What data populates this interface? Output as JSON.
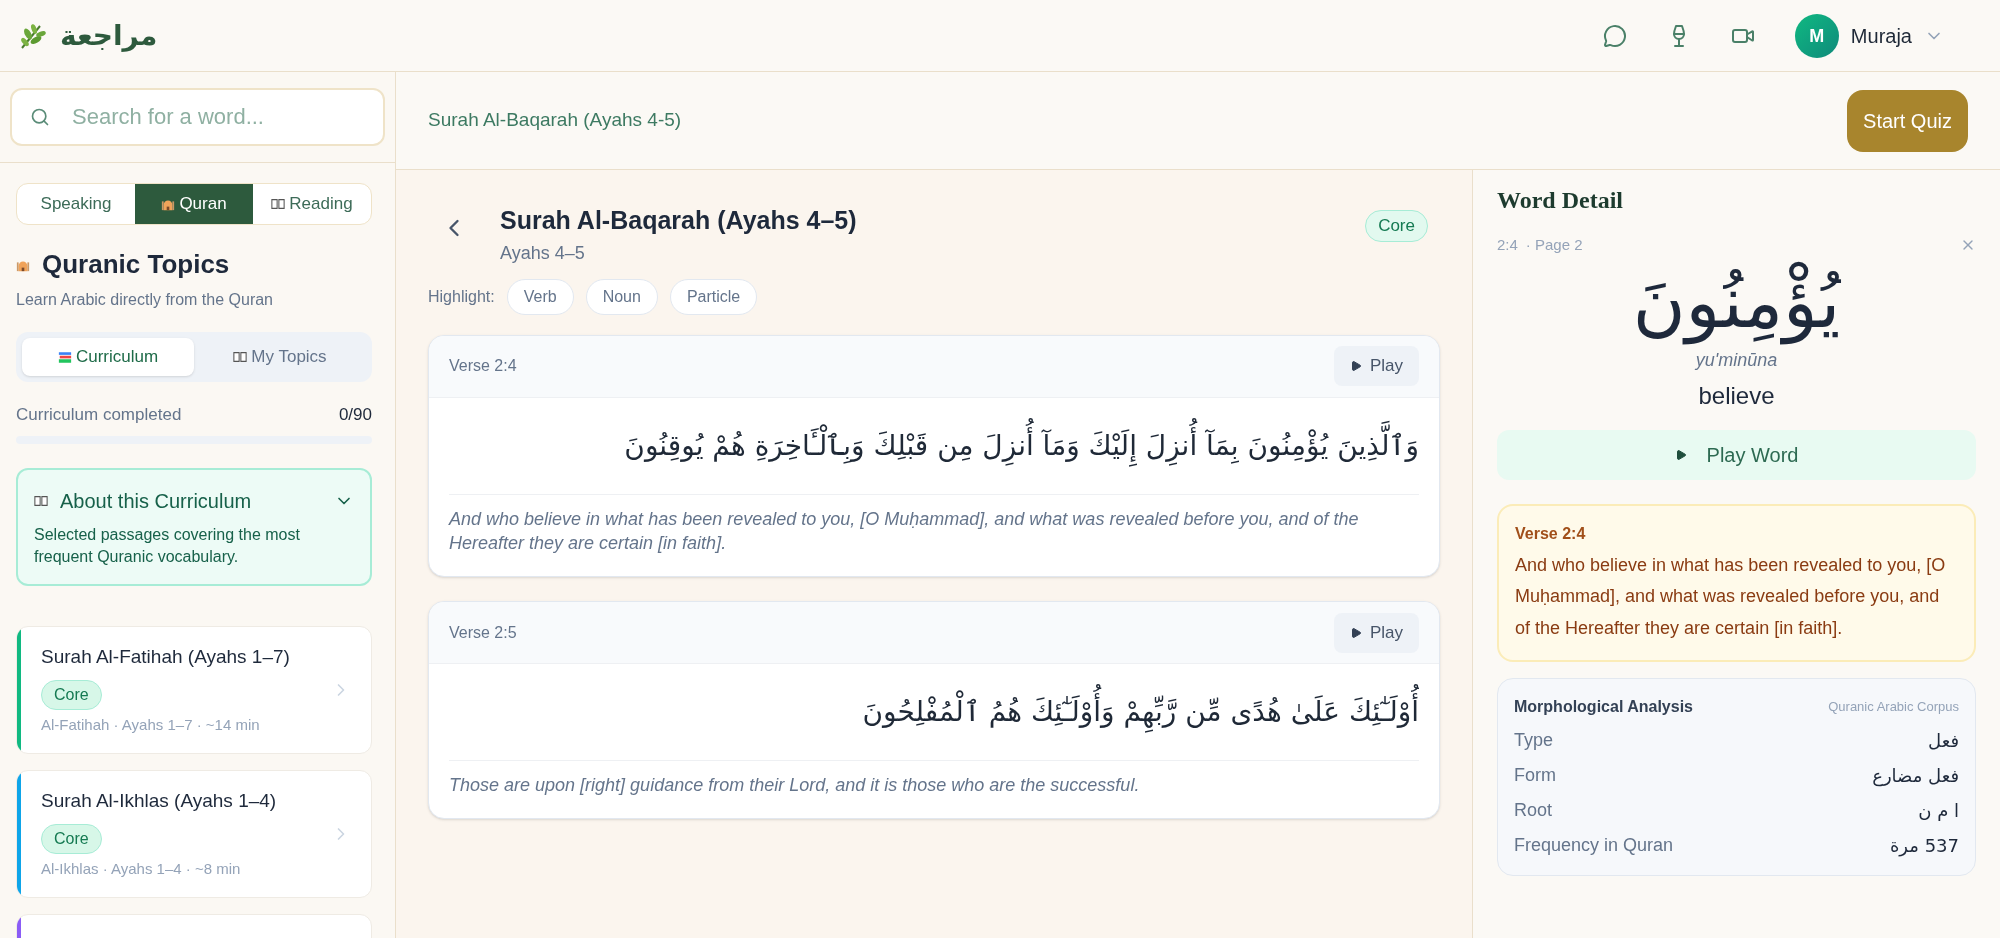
{
  "header": {
    "logo_text": "مراجعة",
    "user": {
      "initial": "M",
      "name": "Muraja"
    }
  },
  "sidebar": {
    "search": {
      "placeholder": "Search for a word..."
    },
    "mode_tabs": [
      {
        "label": "Speaking",
        "kind": "plain",
        "selected": false
      },
      {
        "label": "Quran",
        "kind": "mosque",
        "selected": true
      },
      {
        "label": "Reading",
        "kind": "book",
        "selected": false
      }
    ],
    "section_title": "Quranic Topics",
    "section_subtitle": "Learn Arabic directly from the Quran",
    "sub_tabs": [
      {
        "label": "Curriculum",
        "kind": "books",
        "selected": true
      },
      {
        "label": "My Topics",
        "kind": "book",
        "selected": false
      }
    ],
    "progress": {
      "label": "Curriculum completed",
      "count": "0/90",
      "level": 0
    },
    "about": {
      "title": "About this Curriculum",
      "text": "Selected passages covering the most frequent Quranic vocabulary.",
      "expanded": true
    },
    "topics": [
      {
        "title": "Surah Al-Fatihah (Ayahs 1–7)",
        "badge": "Core",
        "meta": "Al-Fatihah · Ayahs 1–7 · ~14 min",
        "color": "#10b981"
      },
      {
        "title": "Surah Al-Ikhlas (Ayahs 1–4)",
        "badge": "Core",
        "meta": "Al-Ikhlas · Ayahs 1–4 · ~8 min",
        "color": "#0ea5e9"
      },
      {
        "color": "#8b5cf6"
      }
    ]
  },
  "main": {
    "breadcrumb": "Surah Al-Baqarah (Ayahs 4-5)",
    "start_quiz": "Start Quiz",
    "lesson": {
      "title": "Surah Al-Baqarah (Ayahs 4–5)",
      "subtitle": "Ayahs 4–5",
      "badge": "Core"
    },
    "highlight": {
      "label": "Highlight:",
      "chips": [
        {
          "label": "Verb",
          "selected": false
        },
        {
          "label": "Noun",
          "selected": false
        },
        {
          "label": "Particle",
          "selected": false
        }
      ]
    },
    "verses": [
      {
        "label": "Verse 2:4",
        "play": "Play",
        "arabic": "وَٱلَّذِينَ يُؤْمِنُونَ بِمَآ أُنزِلَ إِلَيْكَ وَمَآ أُنزِلَ مِن قَبْلِكَ وَبِٱلْـَٔاخِرَةِ هُمْ يُوقِنُونَ",
        "translation": "And who believe in what has been revealed to you, [O Muḥammad], and what was revealed before you, and of the Hereafter they are certain [in faith]."
      },
      {
        "label": "Verse 2:5",
        "play": "Play",
        "arabic": "أُوْلَـٰٓئِكَ عَلَىٰ هُدًى مِّن رَّبِّهِمْ وَأُوْلَـٰٓئِكَ هُمُ ٱلْمُفْلِحُونَ",
        "translation": "Those are upon [right] guidance from their Lord, and it is those who are the successful."
      }
    ]
  },
  "word_detail": {
    "heading": "Word Detail",
    "ref": "2:4",
    "page": "· Page 2",
    "arabic": "يُؤْمِنُونَ",
    "transliteration": "yu'minūna",
    "meaning": "believe",
    "play": "Play Word",
    "verse_box": {
      "label": "Verse 2:4",
      "text": "And who believe in what has been revealed to you, [O Muḥammad], and what was revealed before you, and of the Hereafter they are certain [in faith]."
    },
    "morphology": {
      "title": "Morphological Analysis",
      "source": "Quranic Arabic Corpus",
      "rows": [
        {
          "label": "Type",
          "value": "فعل"
        },
        {
          "label": "Form",
          "value": "فعل مضارع"
        },
        {
          "label": "Root",
          "value": "ا م ن"
        },
        {
          "label": "Frequency in Quran",
          "value": "537 مرة"
        }
      ]
    }
  }
}
